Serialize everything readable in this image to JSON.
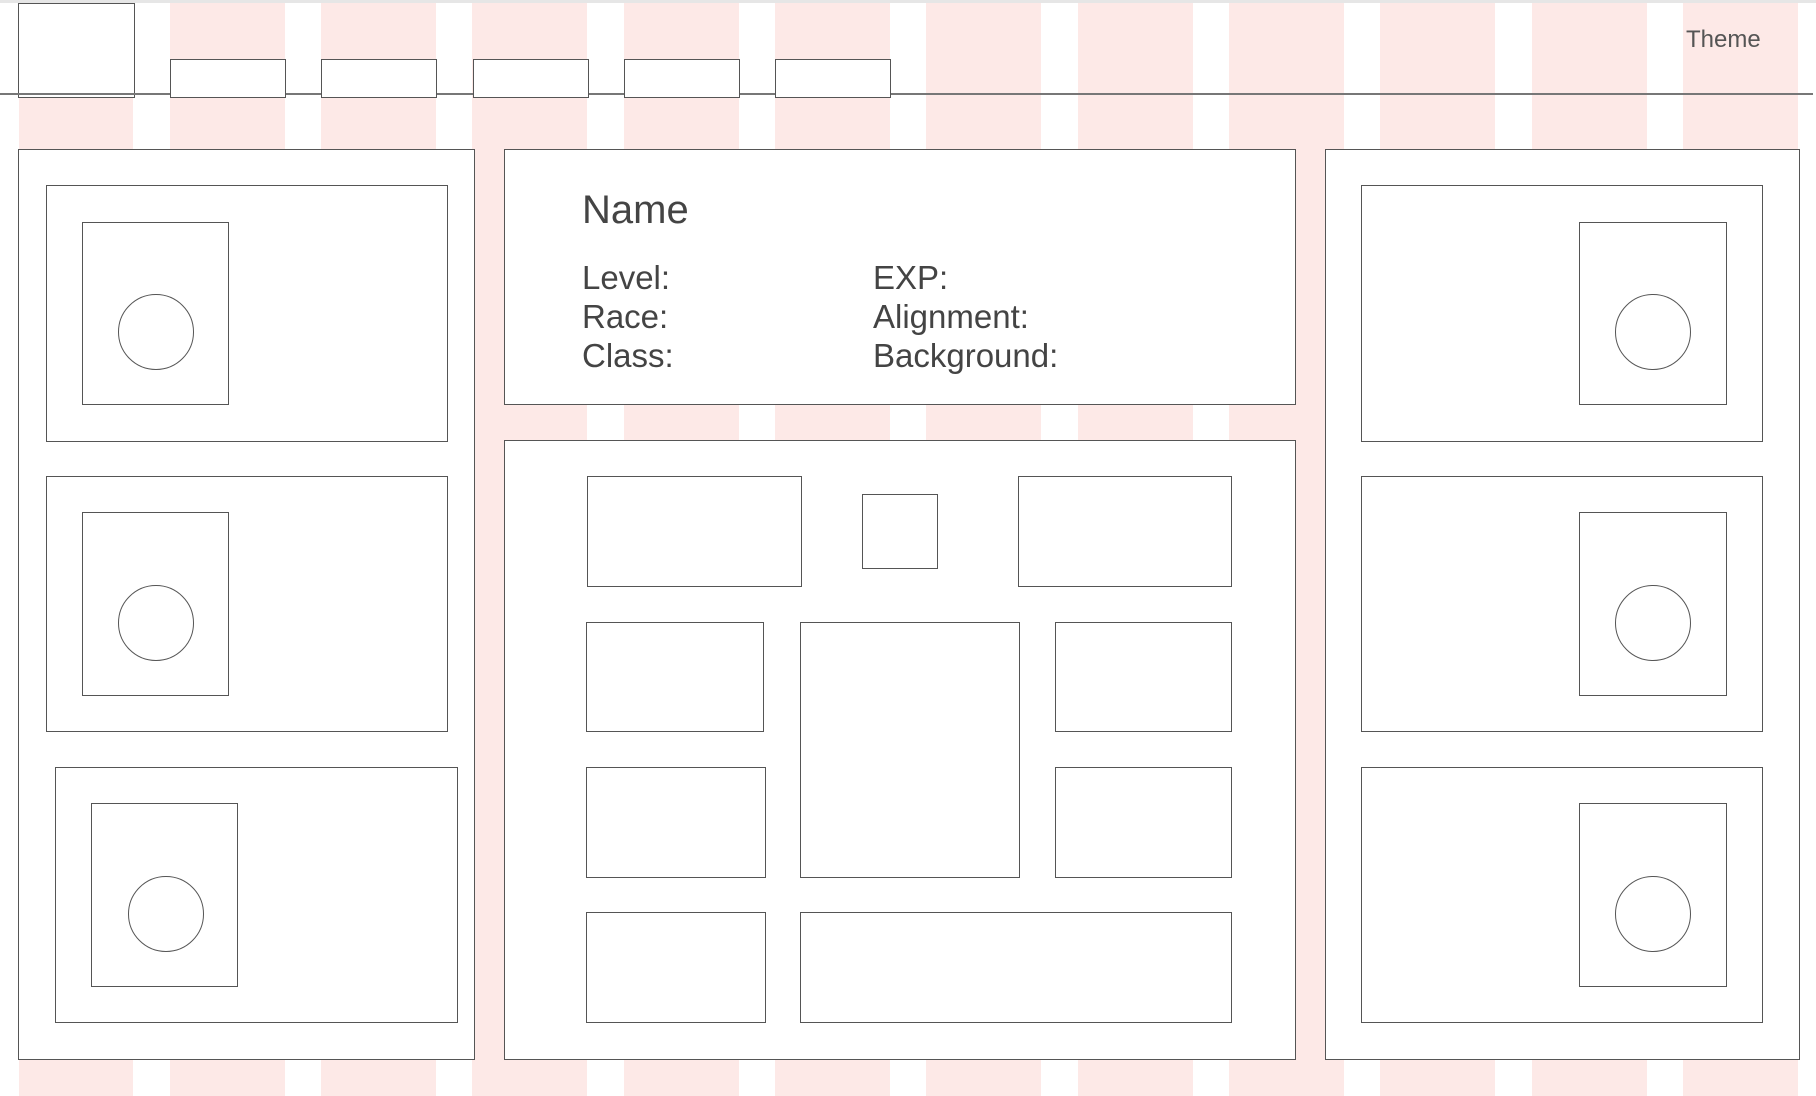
{
  "header": {
    "theme_label": "Theme"
  },
  "character": {
    "name": "Name",
    "fields_left": [
      "Level:",
      "Race:",
      "Class:"
    ],
    "fields_right": [
      "EXP:",
      "Alignment:",
      "Background:"
    ]
  },
  "colors": {
    "grid_column": "#fde9e7",
    "outline": "#555555",
    "text": "#444444",
    "nav_line": "#777777"
  },
  "icons": {
    "portrait_placeholder": "circle-outline"
  }
}
